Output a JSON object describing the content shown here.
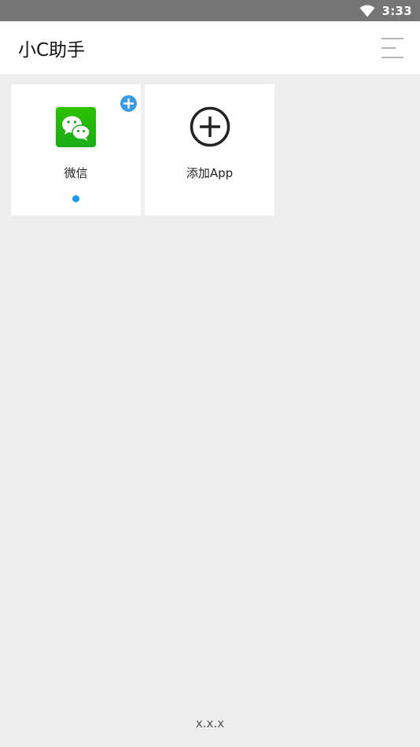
{
  "status_bar": {
    "time": "3:33",
    "icon": "wifi-icon"
  },
  "app_bar": {
    "title": "小C助手",
    "menu_icon": "menu-icon"
  },
  "apps": [
    {
      "label": "微信",
      "icon": "wechat-icon",
      "badge_icon": "add-circle-icon",
      "active": true
    },
    {
      "label": "添加App",
      "icon": "add-circle-outline-icon"
    }
  ],
  "footer": {
    "version": "x.x.x"
  },
  "colors": {
    "status_bar": "#757575",
    "background": "#eeeeee",
    "accent": "#1a9ae8",
    "badge": "#3a9be8",
    "wechat_green": "#1aad19"
  }
}
